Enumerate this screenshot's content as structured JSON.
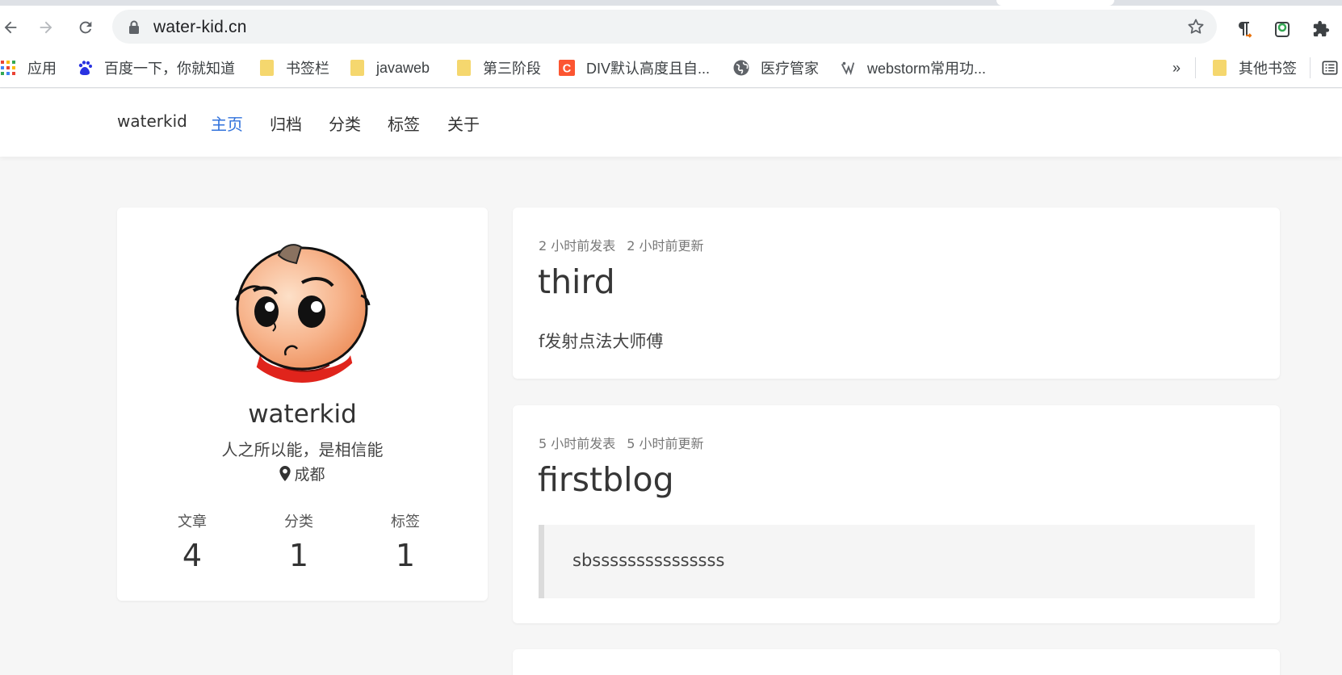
{
  "browser": {
    "url": "water-kid.cn",
    "bookmarks": [
      {
        "label": "应用",
        "icon": "apps-grid-icon"
      },
      {
        "label": "百度一下，你就知道",
        "icon": "baidu-paw-icon"
      },
      {
        "label": "书签栏",
        "icon": "folder-icon"
      },
      {
        "label": "javaweb",
        "icon": "folder-icon"
      },
      {
        "label": "第三阶段",
        "icon": "folder-icon"
      },
      {
        "label": "DIV默认高度且自...",
        "icon": "csdn-icon"
      },
      {
        "label": "医疗管家",
        "icon": "globe-icon"
      },
      {
        "label": "webstorm常用功...",
        "icon": "webstorm-icon"
      }
    ],
    "overflow_label": "»",
    "other_bookmarks": "其他书签"
  },
  "site": {
    "brand": "waterkid",
    "nav": [
      "主页",
      "归档",
      "分类",
      "标签",
      "关于"
    ]
  },
  "profile": {
    "name": "waterkid",
    "motto": "人之所以能，是相信能",
    "location": "成都",
    "stats": [
      {
        "label": "文章",
        "value": "4"
      },
      {
        "label": "分类",
        "value": "1"
      },
      {
        "label": "标签",
        "value": "1"
      }
    ]
  },
  "posts": [
    {
      "published": "2 小时前发表",
      "updated": "2 小时前更新",
      "title": "third",
      "excerpt": "f发射点法大师傅"
    },
    {
      "published": "5 小时前发表",
      "updated": "5 小时前更新",
      "title": "firstblog",
      "quote": "sbsssssssssssssss"
    }
  ],
  "colors": {
    "accent": "#3273dc",
    "background": "#f6f6f6"
  }
}
